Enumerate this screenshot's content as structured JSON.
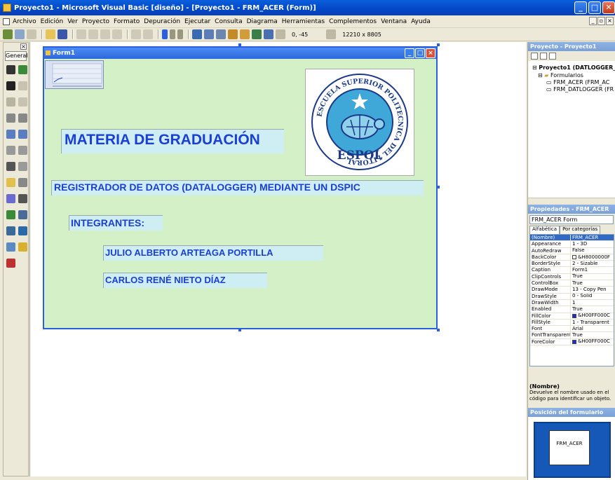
{
  "window": {
    "title": "Proyecto1 - Microsoft Visual Basic [diseño] - [Proyecto1 - FRM_ACER (Form)]",
    "buttons": [
      "_",
      "□",
      "✕"
    ]
  },
  "menu": {
    "items": [
      "Archivo",
      "Edición",
      "Ver",
      "Proyecto",
      "Formato",
      "Depuración",
      "Ejecutar",
      "Consulta",
      "Diagrama",
      "Herramientas",
      "Complementos",
      "Ventana",
      "Ayuda"
    ]
  },
  "toolbar": {
    "position": "0, -45",
    "size": "12210 x 8805"
  },
  "toolbox": {
    "tab_label": "General",
    "tools": [
      "pointer-icon",
      "picturebox-icon",
      "label-icon",
      "textbox-icon",
      "frame-icon",
      "commandbutton-icon",
      "checkbox-icon",
      "optionbutton-icon",
      "combobox-icon",
      "listbox-icon",
      "hscrollbar-icon",
      "vscrollbar-icon",
      "timer-icon",
      "drivelistbox-icon",
      "dirlistbox-icon",
      "filelistbox-icon",
      "shape-icon",
      "line-icon",
      "image-icon",
      "data-icon",
      "ole-icon",
      "mschart-icon",
      "mscomm-icon",
      "grid-icon",
      "misc-icon"
    ]
  },
  "form": {
    "caption": "Form1",
    "labels": {
      "materia": "MATERIA DE GRADUACIÓN",
      "registrador": "REGISTRADOR DE DATOS (DATALOGGER) MEDIANTE UN DSPIC",
      "integrantes": "INTEGRANTES:",
      "julio": "JULIO ALBERTO ARTEAGA PORTILLA",
      "carlos": "CARLOS RENÉ NIETO DÍAZ"
    },
    "logo": {
      "ring_text": "ESCUELA SUPERIOR POLITECNICA DEL LITORAL",
      "name": "ESPOL"
    },
    "background_color": "#d3f0c7",
    "label_text_color": "#1a3fd2"
  },
  "project_explorer": {
    "title": "Proyecto - Proyecto1",
    "root": "Proyecto1 (DATLOGGER_",
    "folder": "Formularios",
    "items": [
      "FRM_ACER (FRM_AC",
      "FRM_DATLOGGER (FR"
    ]
  },
  "properties": {
    "title": "Propiedades - FRM_ACER",
    "object": "FRM_ACER Form",
    "tabs": [
      "Alfabética",
      "Por categorías"
    ],
    "rows": [
      {
        "name": "(Nombre)",
        "value": "FRM_ACER",
        "selected": true
      },
      {
        "name": "Appearance",
        "value": "1 - 3D"
      },
      {
        "name": "AutoRedraw",
        "value": "False"
      },
      {
        "name": "BackColor",
        "value": "&H8000000F",
        "swatch": "#ffffff"
      },
      {
        "name": "BorderStyle",
        "value": "2 - Sizable"
      },
      {
        "name": "Caption",
        "value": "Form1"
      },
      {
        "name": "ClipControls",
        "value": "True"
      },
      {
        "name": "ControlBox",
        "value": "True"
      },
      {
        "name": "DrawMode",
        "value": "13 - Copy Pen"
      },
      {
        "name": "DrawStyle",
        "value": "0 - Solid"
      },
      {
        "name": "DrawWidth",
        "value": "1"
      },
      {
        "name": "Enabled",
        "value": "True"
      },
      {
        "name": "FillColor",
        "value": "&H00FF000C",
        "swatch": "#1a2fd0"
      },
      {
        "name": "FillStyle",
        "value": "1 - Transparent"
      },
      {
        "name": "Font",
        "value": "Arial"
      },
      {
        "name": "FontTransparent",
        "value": "True"
      },
      {
        "name": "ForeColor",
        "value": "&H00FF000C",
        "swatch": "#1a2fd0"
      }
    ],
    "desc_title": "(Nombre)",
    "desc_text": "Devuelve el nombre usado en el código para identificar un objeto."
  },
  "form_layout": {
    "title": "Posición del formulario",
    "form_name": "FRM_ACER"
  }
}
